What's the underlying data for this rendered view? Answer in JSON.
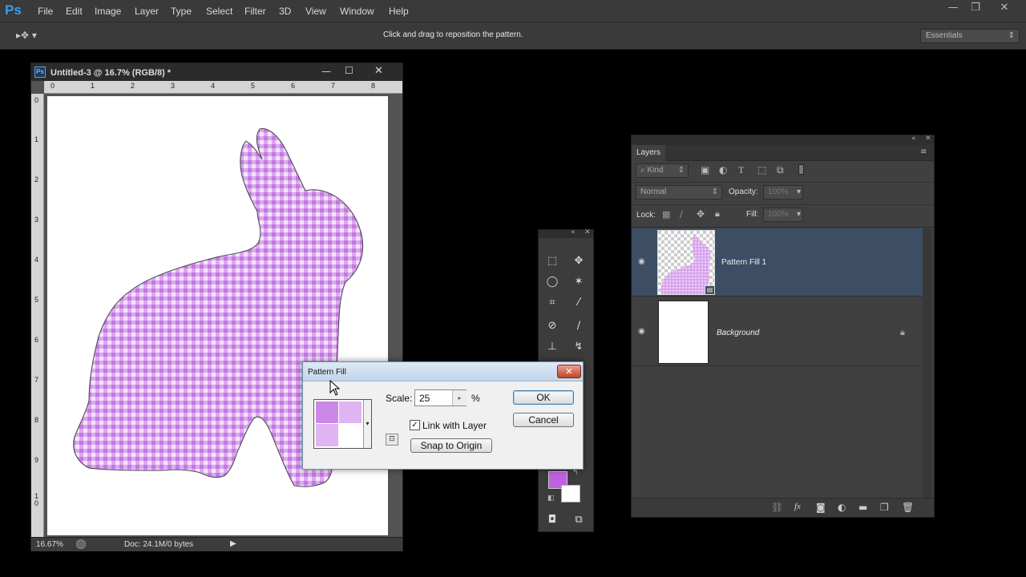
{
  "app": {
    "logo": "Ps",
    "menu": [
      "File",
      "Edit",
      "Image",
      "Layer",
      "Type",
      "Select",
      "Filter",
      "3D",
      "View",
      "Window",
      "Help"
    ]
  },
  "options_bar": {
    "hint": "Click and drag to reposition the pattern.",
    "workspace": "Essentials"
  },
  "document": {
    "title": "Untitled-3 @ 16.7% (RGB/8) *",
    "zoom": "16.67%",
    "doc_info": "Doc: 24.1M/0 bytes",
    "ruler_top": [
      "0",
      "1",
      "2",
      "3",
      "4",
      "5",
      "6",
      "7",
      "8"
    ],
    "ruler_left": [
      "0",
      "1",
      "2",
      "3",
      "4",
      "5",
      "6",
      "7",
      "8",
      "9",
      "1\n0"
    ]
  },
  "dialog": {
    "title": "Pattern Fill",
    "scale_label": "Scale:",
    "scale_value": "25",
    "percent": "%",
    "link_with_layer": "Link with Layer",
    "link_checked": true,
    "snap_button": "Snap to Origin",
    "ok": "OK",
    "cancel": "Cancel"
  },
  "layers_panel": {
    "tab": "Layers",
    "filter_kind": "Kind",
    "blend_mode": "Normal",
    "opacity_label": "Opacity:",
    "opacity_value": "100%",
    "lock_label": "Lock:",
    "fill_label": "Fill:",
    "fill_value": "100%",
    "layers": [
      {
        "name": "Pattern Fill 1",
        "selected": true
      },
      {
        "name": "Background",
        "selected": false,
        "locked": true
      }
    ]
  },
  "colors": {
    "foreground": "#c060e0",
    "background": "#ffffff",
    "pattern": "#cc88e8",
    "selected_layer": "#3d4d63"
  }
}
